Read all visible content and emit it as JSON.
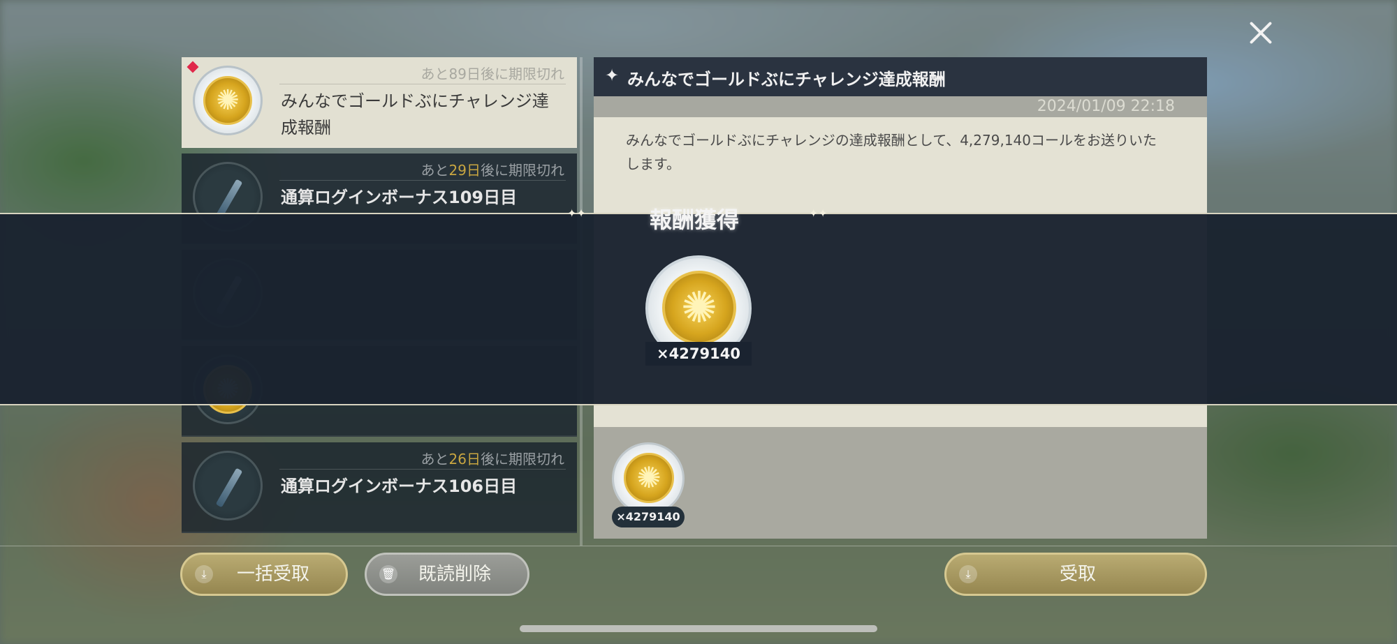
{
  "mail_list": [
    {
      "expiry_prefix": "あと",
      "expiry_days": "89日",
      "expiry_suffix": "後に期限切れ",
      "title": "みんなでゴールドぶにチャレンジ達成報酬",
      "thumb": "gold-coin-icon",
      "selected": true,
      "unread": true
    },
    {
      "expiry_prefix": "あと",
      "expiry_days": "29日",
      "expiry_suffix": "後に期限切れ",
      "title": "通算ログインボーナス109日目",
      "thumb": "key-icon",
      "selected": false,
      "unread": false
    },
    {
      "expiry_prefix": "あと",
      "expiry_days": "26日",
      "expiry_suffix": "後に期限切れ",
      "title": "通算ログインボーナス106日目",
      "thumb": "key-icon",
      "selected": false,
      "unread": false
    }
  ],
  "detail": {
    "title": "みんなでゴールドぶにチャレンジ達成報酬",
    "date": "2024/01/09 22:18",
    "body": "みんなでゴールドぶにチャレンジの達成報酬として、4,279,140コールをお送りいたします。",
    "attachment_count": "×4279140"
  },
  "reward_popup": {
    "title": "報酬獲得",
    "count": "×4279140"
  },
  "buttons": {
    "receive_all": "一括受取",
    "delete_read": "既読削除",
    "receive": "受取"
  },
  "colors": {
    "accent_gold": "#c9a641",
    "unread_marker": "#e0284a",
    "banner": "#1a2330"
  }
}
